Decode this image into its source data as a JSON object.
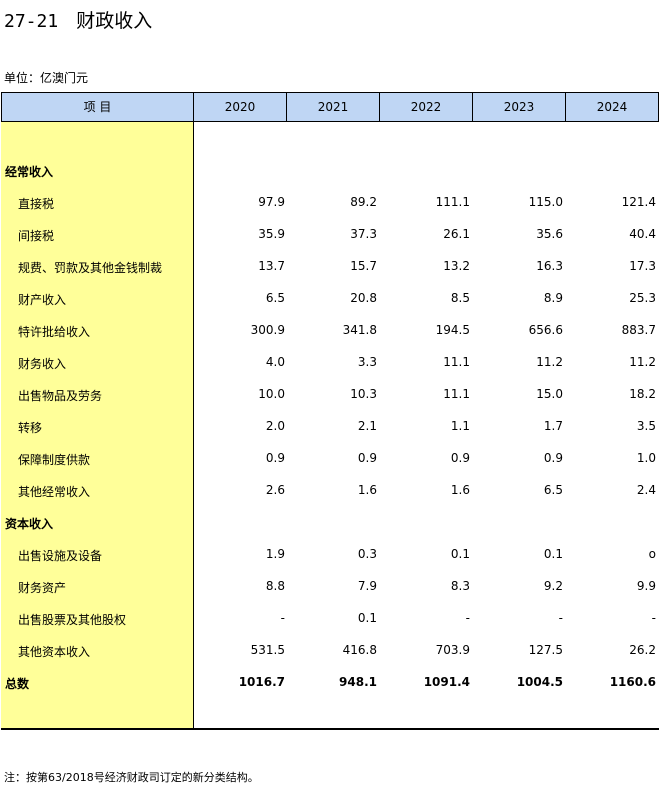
{
  "title": {
    "number": "27-21",
    "text": "财政收入"
  },
  "unit": "单位：亿澳门元",
  "table": {
    "header_item": "项      目",
    "years": [
      "2020",
      "2021",
      "2022",
      "2023",
      "2024"
    ],
    "rows": [
      {
        "type": "section",
        "label": "经常收入",
        "values": [
          "",
          "",
          "",
          "",
          ""
        ]
      },
      {
        "type": "item",
        "label": "直接税",
        "values": [
          "97.9",
          "89.2",
          "111.1",
          "115.0",
          "121.4"
        ]
      },
      {
        "type": "item",
        "label": "间接税",
        "values": [
          "35.9",
          "37.3",
          "26.1",
          "35.6",
          "40.4"
        ]
      },
      {
        "type": "item",
        "label": "规费、罚款及其他金钱制裁",
        "values": [
          "13.7",
          "15.7",
          "13.2",
          "16.3",
          "17.3"
        ]
      },
      {
        "type": "item",
        "label": "财产收入",
        "values": [
          "6.5",
          "20.8",
          "8.5",
          "8.9",
          "25.3"
        ]
      },
      {
        "type": "item",
        "label": "特许批给收入",
        "values": [
          "300.9",
          "341.8",
          "194.5",
          "656.6",
          "883.7"
        ]
      },
      {
        "type": "item",
        "label": "财务收入",
        "values": [
          "4.0",
          "3.3",
          "11.1",
          "11.2",
          "11.2"
        ]
      },
      {
        "type": "item",
        "label": "出售物品及劳务",
        "values": [
          "10.0",
          "10.3",
          "11.1",
          "15.0",
          "18.2"
        ]
      },
      {
        "type": "item",
        "label": "转移",
        "values": [
          "2.0",
          "2.1",
          "1.1",
          "1.7",
          "3.5"
        ]
      },
      {
        "type": "item",
        "label": "保障制度供款",
        "values": [
          "0.9",
          "0.9",
          "0.9",
          "0.9",
          "1.0"
        ]
      },
      {
        "type": "item",
        "label": "其他经常收入",
        "values": [
          "2.6",
          "1.6",
          "1.6",
          "6.5",
          "2.4"
        ]
      },
      {
        "type": "section",
        "label": "资本收入",
        "values": [
          "",
          "",
          "",
          "",
          ""
        ]
      },
      {
        "type": "item",
        "label": "出售设施及设备",
        "values": [
          "1.9",
          "0.3",
          "0.1",
          "0.1",
          "o"
        ]
      },
      {
        "type": "item",
        "label": "财务资产",
        "values": [
          "8.8",
          "7.9",
          "8.3",
          "9.2",
          "9.9"
        ]
      },
      {
        "type": "item",
        "label": "出售股票及其他股权",
        "values": [
          "-",
          "0.1",
          "-",
          "-",
          "-"
        ]
      },
      {
        "type": "item",
        "label": "其他资本收入",
        "values": [
          "531.5",
          "416.8",
          "703.9",
          "127.5",
          "26.2"
        ]
      },
      {
        "type": "total",
        "label": "总数",
        "values": [
          "1016.7",
          "948.1",
          "1091.4",
          "1004.5",
          "1160.6"
        ]
      }
    ]
  },
  "note": "注：按第63/2018号经济财政司订定的新分类结构。",
  "colors": {
    "header_bg": "#bfd6f4",
    "label_col_bg": "#ffff99"
  }
}
